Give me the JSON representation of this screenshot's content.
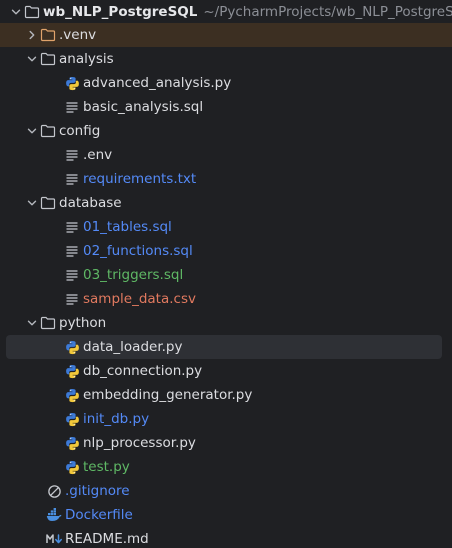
{
  "root": {
    "name": "wb_NLP_PostgreSQL",
    "path": "~/PycharmProjects/wb_NLP_PostgreSQL"
  },
  "items": [
    {
      "label": ".venv",
      "kind": "folder",
      "state": "collapsed",
      "color": "#e0a36b"
    },
    {
      "label": "analysis",
      "kind": "folder",
      "state": "expanded"
    },
    {
      "label": "advanced_analysis.py",
      "kind": "python-file"
    },
    {
      "label": "basic_analysis.sql",
      "kind": "text-file"
    },
    {
      "label": "config",
      "kind": "folder",
      "state": "expanded"
    },
    {
      "label": ".env",
      "kind": "text-file"
    },
    {
      "label": "requirements.txt",
      "kind": "text-file",
      "color": "#548af7"
    },
    {
      "label": "database",
      "kind": "folder",
      "state": "expanded"
    },
    {
      "label": "01_tables.sql",
      "kind": "text-file",
      "color": "#548af7"
    },
    {
      "label": "02_functions.sql",
      "kind": "text-file",
      "color": "#548af7"
    },
    {
      "label": "03_triggers.sql",
      "kind": "text-file",
      "color": "#5fb865"
    },
    {
      "label": "sample_data.csv",
      "kind": "text-file",
      "color": "#e0795f"
    },
    {
      "label": "python",
      "kind": "folder",
      "state": "expanded"
    },
    {
      "label": "data_loader.py",
      "kind": "python-file",
      "selected": true
    },
    {
      "label": "db_connection.py",
      "kind": "python-file"
    },
    {
      "label": "embedding_generator.py",
      "kind": "python-file"
    },
    {
      "label": "init_db.py",
      "kind": "python-file",
      "color": "#548af7"
    },
    {
      "label": "nlp_processor.py",
      "kind": "python-file"
    },
    {
      "label": "test.py",
      "kind": "python-file",
      "color": "#5fb865"
    },
    {
      "label": ".gitignore",
      "kind": "ignore-file",
      "color": "#548af7"
    },
    {
      "label": "Dockerfile",
      "kind": "docker-file",
      "color": "#548af7"
    },
    {
      "label": "README.md",
      "kind": "markdown-file"
    }
  ],
  "icons": {
    "chevron-down": "chevron-down-icon",
    "chevron-right": "chevron-right-icon",
    "folder": "folder-icon",
    "python": "python-file-icon",
    "text": "text-file-icon",
    "ignore": "gitignore-icon",
    "docker": "docker-icon",
    "markdown": "markdown-icon"
  }
}
